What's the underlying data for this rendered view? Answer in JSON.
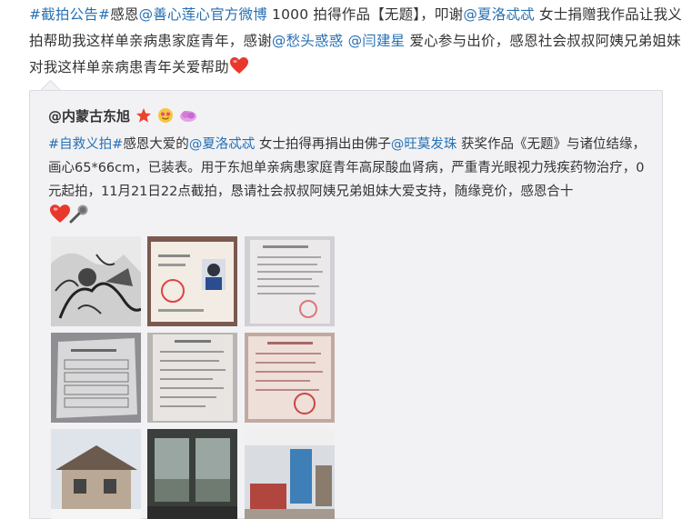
{
  "post": {
    "hashtag1": "#截拍公告#",
    "t1": "感恩",
    "mention1": "@善心莲心官方微博",
    "t2": " 1000 拍得作品【无题】，叩谢",
    "mention2": "@夏洛忒忒",
    "t3": " 女士捐赠我作品让我义拍帮助我这样单亲病患家庭青年，感谢",
    "mention3": "@愁头惑惑",
    "t4": " ",
    "mention4": "@闫建星",
    "t5": " 爱心参与出价，感恩社会叔叔阿姨兄弟姐妹对我这样单亲病患青年关爱帮助",
    "heart_icon": "red-heart-emoji"
  },
  "repost": {
    "author": "@内蒙古东旭",
    "author_badges": [
      "star-badge-icon",
      "face-emoji-icon",
      "cloud-badge-icon"
    ],
    "hashtag": "#自救义拍#",
    "t1": "感恩大爱的",
    "mention1": "@夏洛忒忒",
    "t2": " 女士拍得再捐出由佛子",
    "mention2": "@旺莫发珠",
    "t3": " 获奖作品《无题》与诸位结缘，画心65*66cm，已装表。用于东旭单亲病患家庭青年高尿酸血肾病，严重青光眼视力残疾药物治疗，0元起拍，11月21日22点截拍，恳请社会叔叔阿姨兄弟姐妹大爱支持，随缘竞价，感恩合十",
    "emoji": [
      "heart-emoji-icon",
      "microphone-emoji-icon"
    ]
  },
  "thumbnails": [
    {
      "name": "thumb-artwork-ink"
    },
    {
      "name": "thumb-id-certificate"
    },
    {
      "name": "thumb-document-1"
    },
    {
      "name": "thumb-document-2"
    },
    {
      "name": "thumb-document-3"
    },
    {
      "name": "thumb-document-4"
    },
    {
      "name": "thumb-house-snow"
    },
    {
      "name": "thumb-window-view"
    },
    {
      "name": "thumb-room-interior"
    }
  ],
  "colors": {
    "link": "#2770b4",
    "text": "#333333",
    "repost_bg": "#f2f2f5"
  }
}
